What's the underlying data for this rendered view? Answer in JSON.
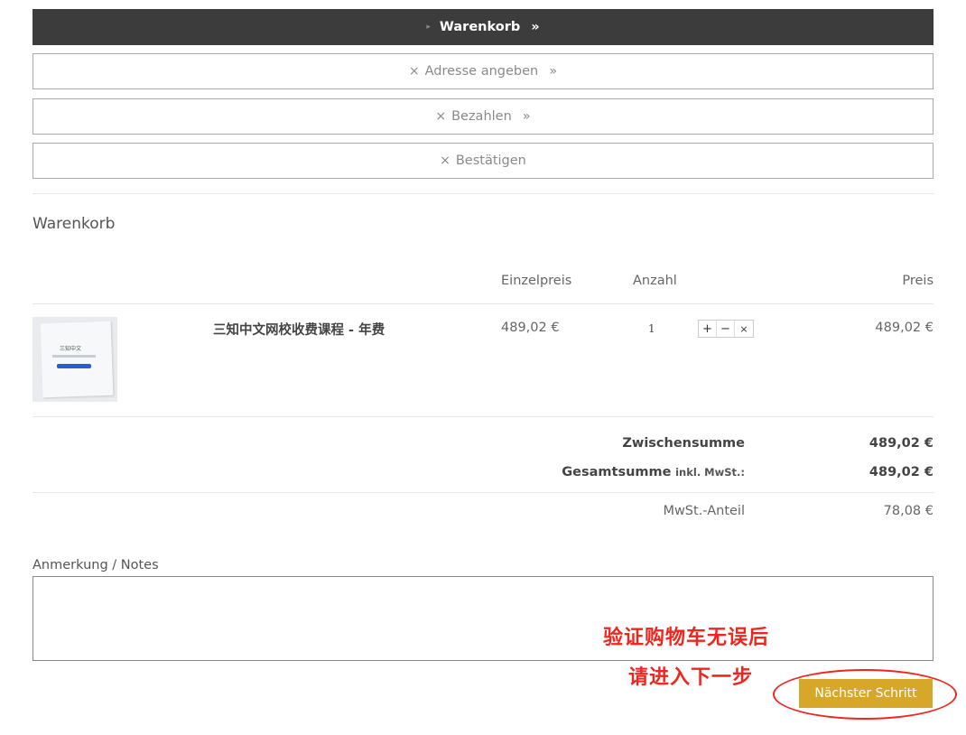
{
  "steps": {
    "cart": "Warenkorb",
    "address": "Adresse angeben",
    "payment": "Bezahlen",
    "confirm": "Bestätigen",
    "x_mark": "×",
    "raquo": "»",
    "triangle": "▸"
  },
  "cart": {
    "title": "Warenkorb",
    "headers": {
      "unit_price": "Einzelpreis",
      "quantity": "Anzahl",
      "price": "Preis"
    },
    "items": [
      {
        "thumbnail_title": "三知中文",
        "name": "三知中文网校收费课程 - 年费",
        "unit_price": "489,02 €",
        "quantity": "1",
        "price": "489,02 €",
        "controls": {
          "plus": "+",
          "minus": "−",
          "remove": "×"
        }
      }
    ],
    "totals": {
      "subtotal_label": "Zwischensumme",
      "subtotal_value": "489,02 €",
      "total_label": "Gesamtsumme",
      "total_suffix": "inkl. MwSt.:",
      "total_value": "489,02 €",
      "vat_label": "MwSt.-Anteil",
      "vat_value": "78,08 €"
    }
  },
  "notes": {
    "label": "Anmerkung / Notes",
    "value": ""
  },
  "annotation": {
    "line1": "验证购物车无误后",
    "line2": "请进入下一步",
    "color": "#f0261e"
  },
  "next_button": {
    "label": "Nächster Schritt",
    "color": "#d7a72a"
  }
}
